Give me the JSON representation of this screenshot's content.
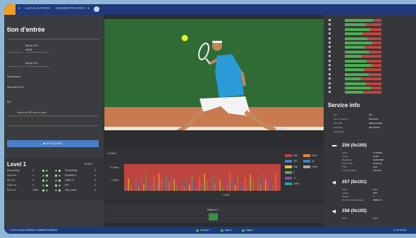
{
  "topbar": {
    "nav_localisation": "LOCALISATION",
    "nav_administration": "ADMINISTRATION"
  },
  "left": {
    "title": "tion d'entrée",
    "fields": [
      "Bitrate PID*",
      "1078",
      "Bitrate PID*",
      "Redondance",
      "Alternative FEC",
      "Valeur du PID (hex ou dec)"
    ],
    "apply_label": "APPLIQUER",
    "level": {
      "title": "Level 1",
      "reset": "RESET",
      "rows": [
        {
          "label": "Scrambling",
          "v": "0"
        },
        {
          "label": "Sync err",
          "v": "0"
        },
        {
          "label": "PAT err",
          "v": "0"
        },
        {
          "label": "Cont. err",
          "v": "0"
        },
        {
          "label": "PMT err",
          "v": "1260"
        }
      ],
      "right_rows": [
        {
          "label": "Scrambling",
          "v": "0"
        },
        {
          "label": "Repetition",
          "v": "0"
        },
        {
          "label": "Table ID",
          "v": "0"
        },
        {
          "label": "PID",
          "v": "0"
        },
        {
          "label": "Sans table",
          "v": "0"
        }
      ]
    }
  },
  "graph": {
    "ylabels": [
      "70 Mb/s",
      "70 Mb/s",
      "0 Mb/s"
    ],
    "xlabel": "13:33",
    "legend": [
      "256",
      "257",
      "258",
      "0",
      "17",
      "4096",
      "8191",
      "16",
      "Other"
    ]
  },
  "datain": {
    "title": "Data in 1"
  },
  "right": {
    "service_title": "Service info",
    "service_kv": [
      [
        "SID",
        "257"
      ],
      [
        "Nom du service",
        "Service01"
      ],
      [
        "PMT PID",
        "4096 (0x1000)"
      ],
      [
        "PCR PID",
        "256 (0x100)"
      ],
      [
        "PID ignorés",
        "-"
      ]
    ],
    "streams": [
      {
        "title": "256 (0x100)",
        "kv": [
          [
            "Débit",
            "12.8 Mb/s"
          ],
          [
            "Codec",
            "H.264"
          ],
          [
            "Résolution",
            "1920x1080"
          ],
          [
            "Frame rate",
            "29.94 fps"
          ],
          [
            "Profil",
            "High"
          ],
          [
            "Color primaries",
            "unknown"
          ]
        ]
      },
      {
        "title": "257 (0x101)",
        "kv": [
          [
            "Débit",
            "0 b/s"
          ],
          [
            "Codec",
            "MP2"
          ],
          [
            "Canaux",
            "2"
          ],
          [
            "Taux d'échantillonnage",
            "48000 Hz"
          ]
        ]
      },
      {
        "title": "258 (0x102)",
        "kv": [
          [
            "Débit",
            "0 b/s"
          ]
        ]
      }
    ]
  },
  "bottombar": {
    "left_text": "V 5.3.0 LA101    R0PNC7-4D8090F7E9E6D1",
    "items": [
      "Control 1",
      "Data 1",
      "Data 2"
    ],
    "time": "13:33:33"
  }
}
